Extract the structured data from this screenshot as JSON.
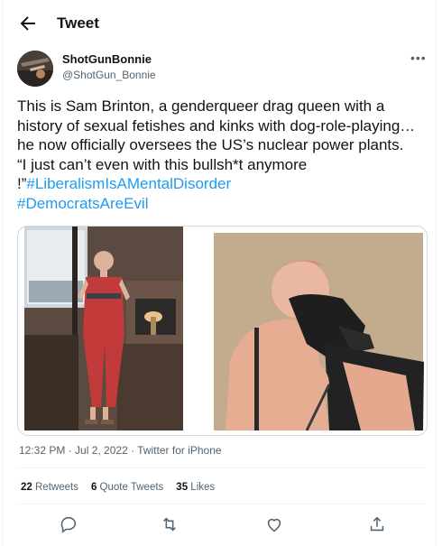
{
  "header": {
    "title": "Tweet"
  },
  "author": {
    "name": "ShotGunBonnie",
    "handle": "@ShotGun_Bonnie"
  },
  "tweet": {
    "text": "This is Sam Brinton, a genderqueer drag queen with a history of sexual fetishes and kinks with dog-role-playing…he now officially oversees the US’s nuclear power plants.        “I just can’t even with this bullsh*t anymore !”",
    "hashtags": [
      "#LiberalismIsAMentalDisorder",
      "#DemocratsAreEvil"
    ]
  },
  "meta": {
    "timestamp": "12:32 PM · Jul 2, 2022 · Twitter for iPhone"
  },
  "stats": {
    "retweets_count": "22",
    "retweets_label": "Retweets",
    "quotes_count": "6",
    "quotes_label": "Quote Tweets",
    "likes_count": "35",
    "likes_label": "Likes"
  },
  "icons": [
    "back-arrow-icon",
    "more-icon",
    "reply-icon",
    "retweet-icon",
    "like-icon",
    "share-icon"
  ],
  "colors": {
    "accent": "#1d9bf0",
    "text": "#0f1419",
    "secondary": "#536471"
  }
}
